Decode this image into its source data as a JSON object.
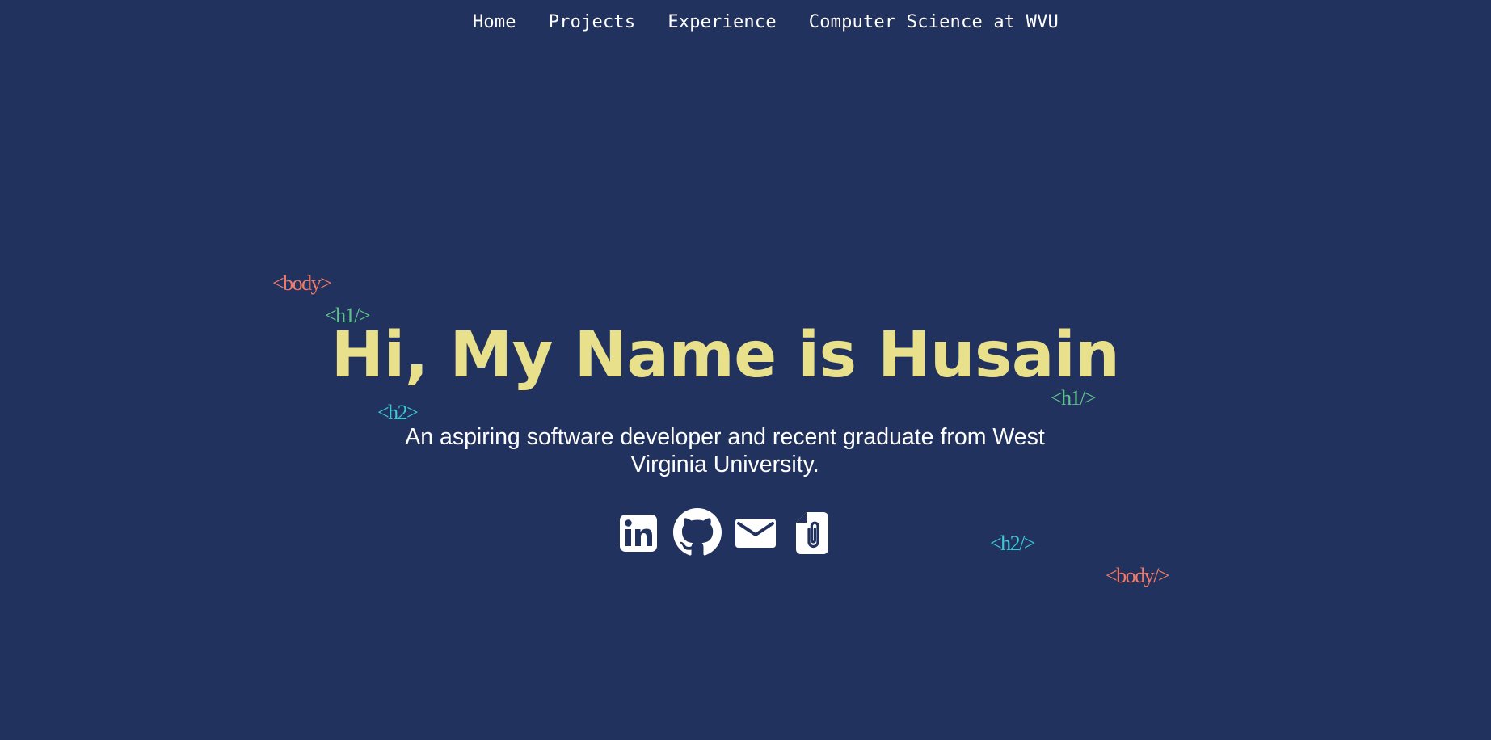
{
  "nav": {
    "items": [
      "Home",
      "Projects",
      "Experience",
      "Computer Science at WVU"
    ]
  },
  "hero": {
    "tags": {
      "body_open": "<body>",
      "h1_open": "<h1/>",
      "h1_close": "<h1/>",
      "h2_open": "<h2>",
      "h2_close": "<h2/>",
      "body_close": "<body/>"
    },
    "headline": "Hi, My Name is Husain",
    "subtitle": "An aspiring software developer and recent graduate from West Virginia University."
  },
  "social_links": [
    {
      "icon": "linkedin-icon"
    },
    {
      "icon": "github-icon"
    },
    {
      "icon": "email-icon"
    },
    {
      "icon": "resume-document-icon"
    }
  ],
  "colors": {
    "background": "#22325e",
    "headline": "#e8e08a",
    "body_tag": "#f07a66",
    "h1_tag": "#5ec38a",
    "h2_tag": "#3fc8d4",
    "text": "#ffffff"
  }
}
